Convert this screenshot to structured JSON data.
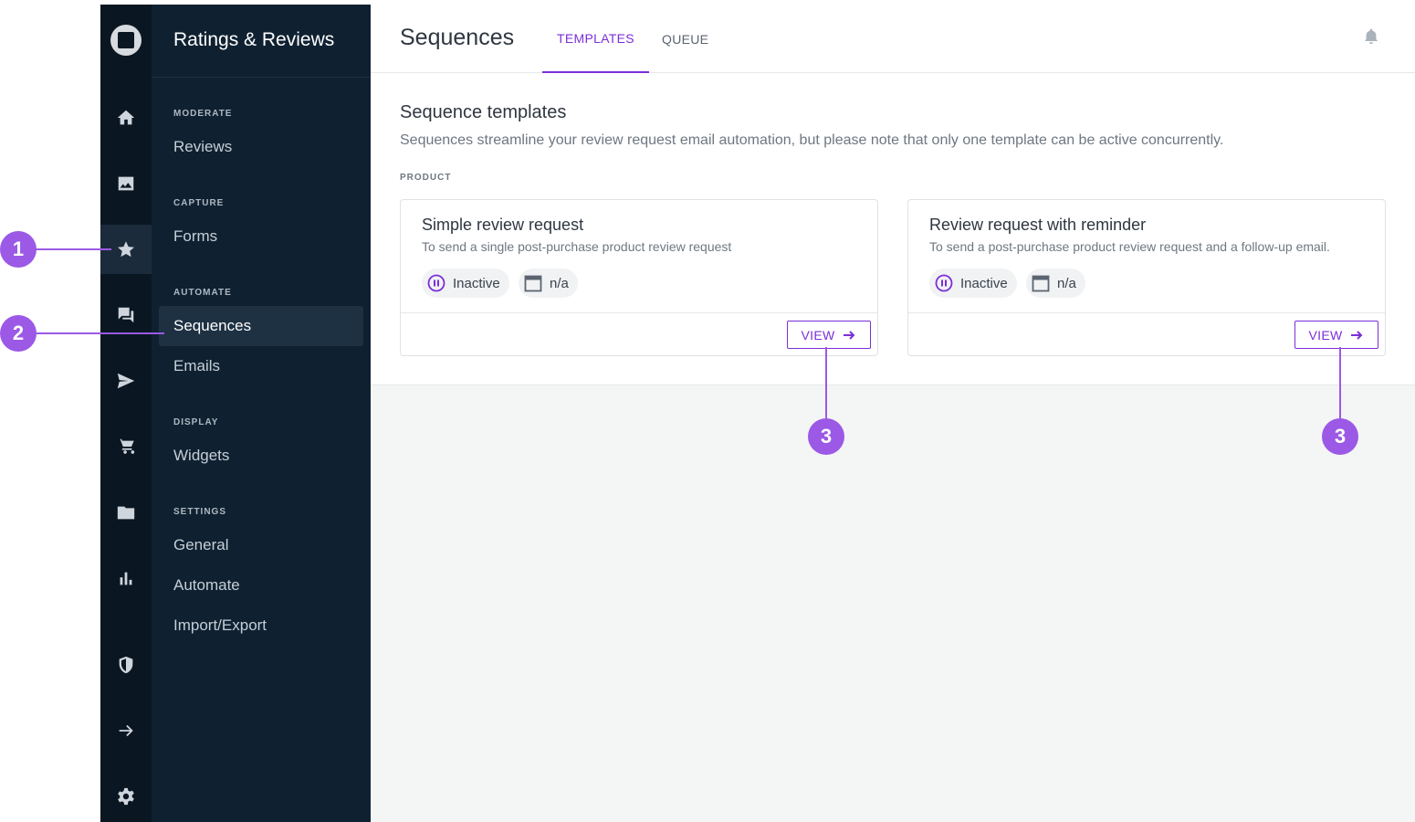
{
  "app": {
    "title": "Ratings & Reviews"
  },
  "rail": {
    "icons": [
      "logo-icon",
      "home-icon",
      "image-icon",
      "star-icon",
      "chat-icon",
      "send-icon",
      "cart-icon",
      "folder-icon",
      "bar-chart-icon",
      "shield-icon",
      "arrow-right-icon",
      "gear-icon"
    ],
    "active": "star-icon"
  },
  "nav": {
    "sections": [
      {
        "label": "MODERATE",
        "items": [
          "Reviews"
        ]
      },
      {
        "label": "CAPTURE",
        "items": [
          "Forms"
        ]
      },
      {
        "label": "AUTOMATE",
        "items": [
          "Sequences",
          "Emails"
        ]
      },
      {
        "label": "DISPLAY",
        "items": [
          "Widgets"
        ]
      },
      {
        "label": "SETTINGS",
        "items": [
          "General",
          "Automate",
          "Import/Export"
        ]
      }
    ],
    "active_item": "Sequences"
  },
  "header": {
    "title": "Sequences",
    "tabs": [
      {
        "label": "TEMPLATES",
        "active": true
      },
      {
        "label": "QUEUE",
        "active": false
      }
    ]
  },
  "main": {
    "section_title": "Sequence templates",
    "section_desc": "Sequences streamline your review request email automation, but please note that only one template can be active concurrently.",
    "group_label": "PRODUCT",
    "cards": [
      {
        "title": "Simple review request",
        "desc": "To send a single post-purchase product review request",
        "status": "Inactive",
        "date": "n/a",
        "button": "VIEW"
      },
      {
        "title": "Review request with reminder",
        "desc": "To send a post-purchase product review request and a follow-up email.",
        "status": "Inactive",
        "date": "n/a",
        "button": "VIEW"
      }
    ]
  },
  "callouts": [
    "1",
    "2",
    "3",
    "3"
  ],
  "colors": {
    "accent": "#7b2fd8",
    "callout": "#9b59e6",
    "rail_bg": "#0a1722",
    "nav_bg": "#0f2131"
  }
}
